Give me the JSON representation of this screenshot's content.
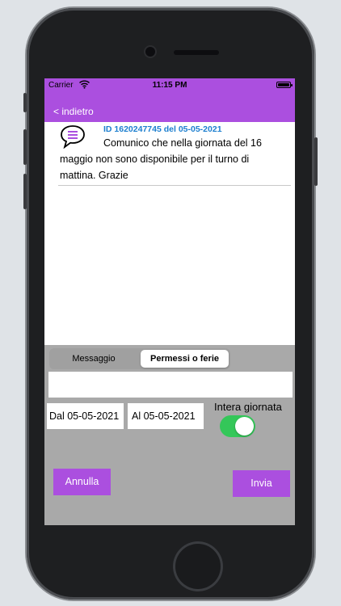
{
  "status_bar": {
    "carrier": "Carrier",
    "time": "11:15 PM"
  },
  "nav": {
    "back_label": "< indietro"
  },
  "message": {
    "id_line": "ID 1620247745 del 05-05-2021",
    "text": "Comunico che nella giornata del 16 maggio non sono disponibile per il turno di mattina. Grazie"
  },
  "compose": {
    "segments": [
      "Messaggio",
      "Permessi o ferie"
    ],
    "selected_segment": "Permessi o ferie",
    "input_value": "",
    "date_from": "Dal 05-05-2021",
    "date_to": "Al 05-05-2021",
    "full_day_label": "Intera giornata",
    "full_day_on": true,
    "cancel_label": "Annulla",
    "send_label": "Invia"
  },
  "colors": {
    "accent": "#ab4fdf",
    "id_text": "#1d7fcf",
    "toggle_on": "#34c759",
    "compose_bg": "#a9a9a9"
  },
  "icons": {
    "message": "speech-bubble-icon",
    "wifi": "wifi-icon",
    "battery": "battery-icon"
  }
}
